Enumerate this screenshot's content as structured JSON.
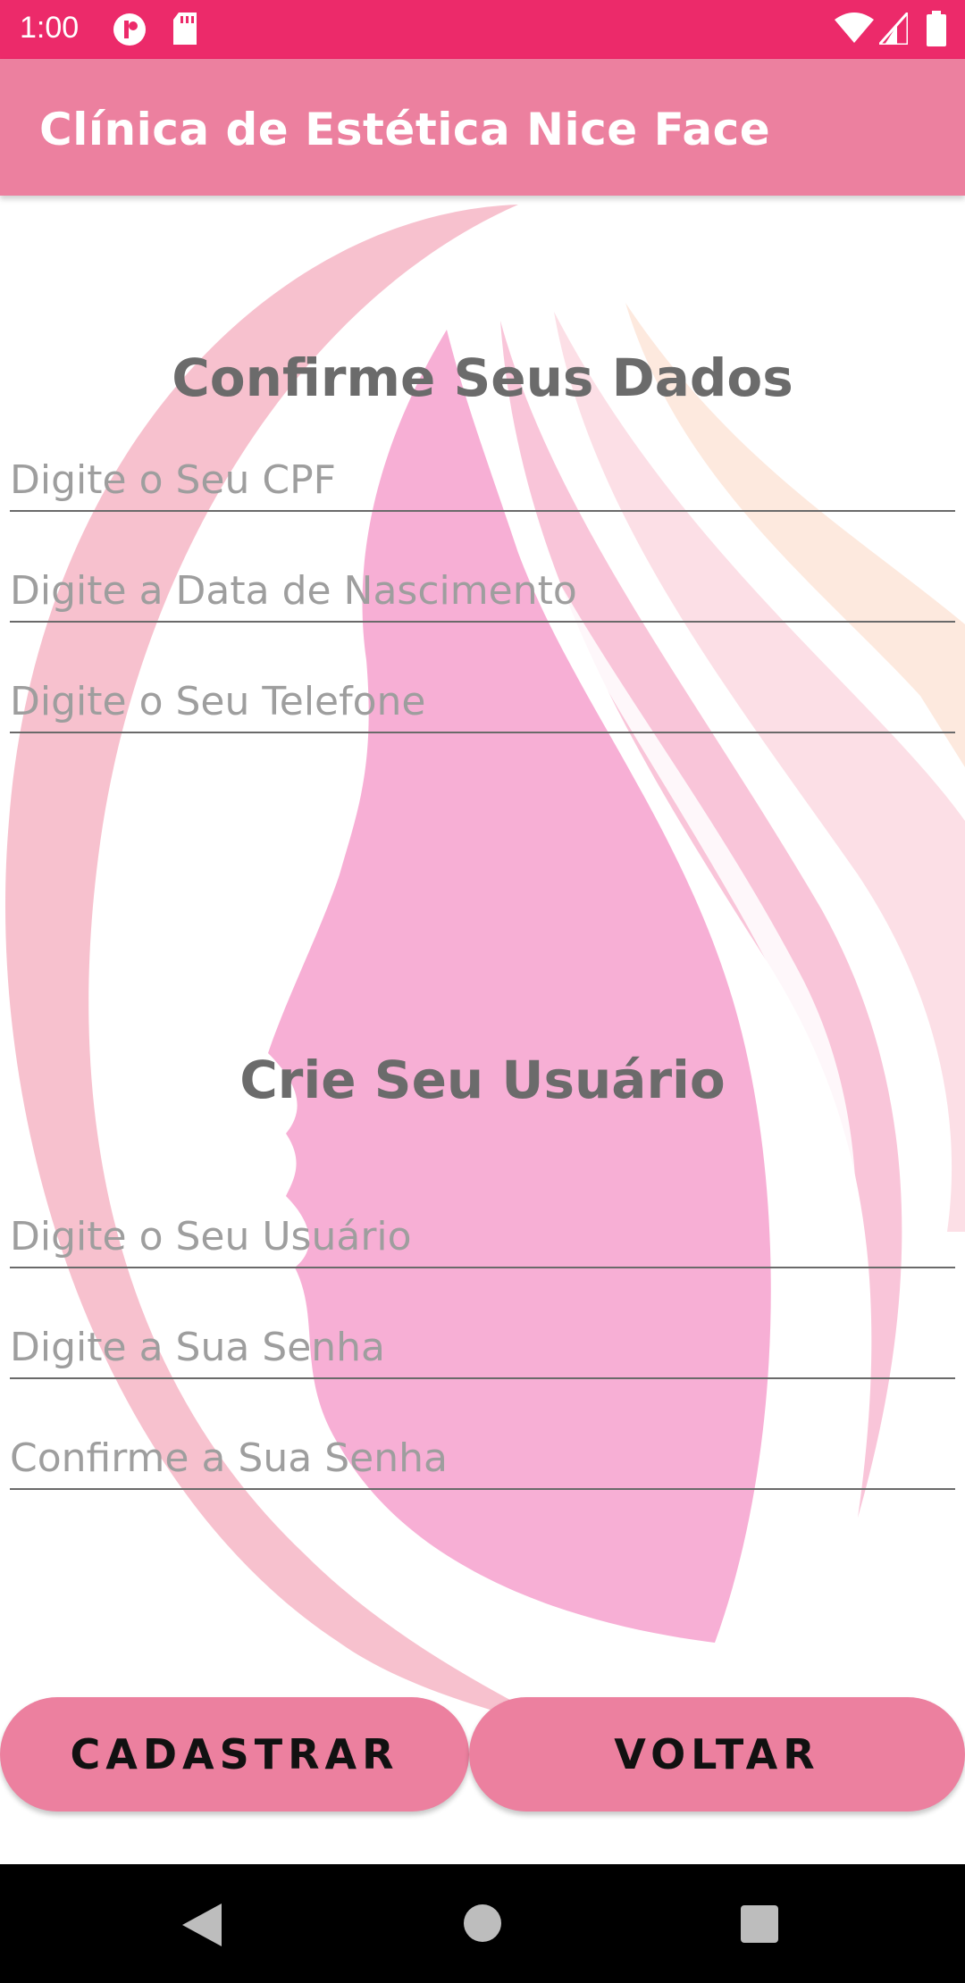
{
  "status_bar": {
    "time": "1:00"
  },
  "app_bar": {
    "title": "Clínica de Estética Nice Face"
  },
  "section_data": {
    "heading": "Confirme Seus Dados",
    "cpf_placeholder": "Digite o Seu CPF",
    "birth_placeholder": "Digite a Data de Nascimento",
    "phone_placeholder": "Digite o Seu Telefone"
  },
  "section_user": {
    "heading": "Crie Seu Usuário",
    "user_placeholder": "Digite o Seu Usuário",
    "password_placeholder": "Digite a Sua Senha",
    "confirm_placeholder": "Confirme a Sua Senha"
  },
  "buttons": {
    "register": "CADASTRAR",
    "back": "VOLTAR"
  },
  "colors": {
    "status_bar": "#ec2a6a",
    "app_bar": "#ec809f",
    "button": "#ec809f"
  }
}
